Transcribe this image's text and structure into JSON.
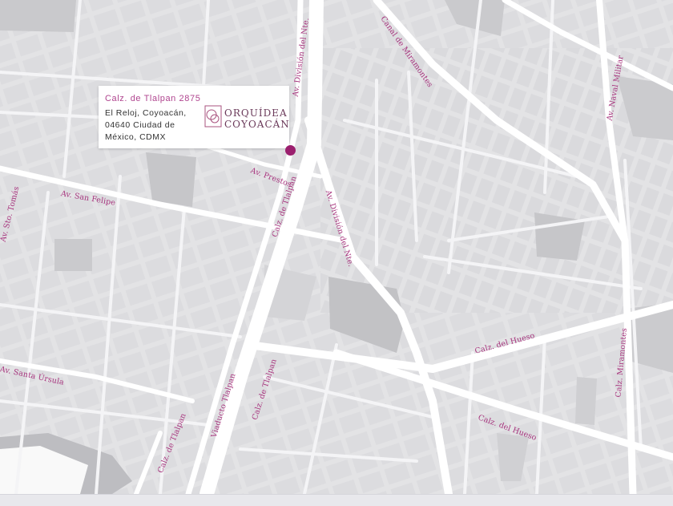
{
  "colors": {
    "pin": "#9b1f6e",
    "label": "#a7337d",
    "title": "#b0458f"
  },
  "address": {
    "title": "Calz. de Tlalpan 2875",
    "line1": "El Reloj, Coyoacán,",
    "line2": "04640 Ciudad de",
    "line3": "México, CDMX"
  },
  "logo": {
    "word1": "ORQUÍDEA",
    "word2": "COYOACÁN",
    "mark_icon": "orchid-monogram-icon"
  },
  "marker": {
    "icon": "location-pin-icon"
  },
  "streets": {
    "div_norte_top": "Av. División del Nte.",
    "div_norte_mid": "Av. División del Nte.",
    "div_norte_right": "Canal de Miramontes",
    "prestos": "Av. Prestos",
    "san_felipe": "Av. San Felipe",
    "tlalpan_mid": "Calz. de Tlalpan",
    "santo_tomas": "Av. Sto. Tomás",
    "santa_ursula": "Av. Santa Úrsula",
    "tlalpan_bottom": "Calz. de Tlalpan",
    "viaducto": "Viaducto Tlalpan",
    "tlalpan_bottom2": "Calz. de Tlalpan",
    "hueso_upper": "Calz. del Hueso",
    "hueso_lower": "Calz. del Hueso",
    "naval": "Av. Naval Militar",
    "miramontes": "Calz. Miramontes"
  }
}
